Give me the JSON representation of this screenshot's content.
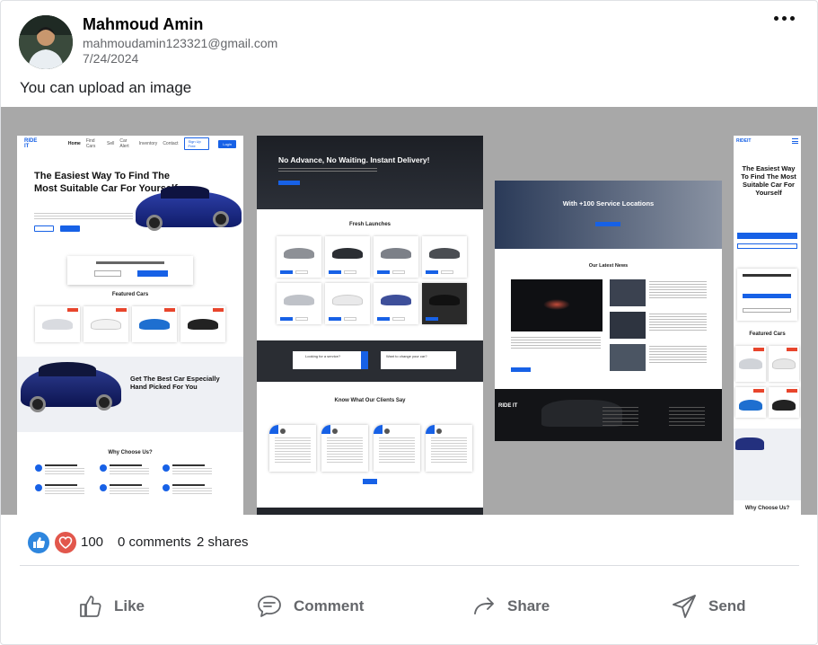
{
  "post": {
    "author": "Mahmoud Amin",
    "email": "mahmoudamin123321@gmail.com",
    "date": "7/24/2024",
    "text": "You can upload an image"
  },
  "gallery": {
    "shot1": {
      "logo": "RIDE IT",
      "nav": [
        "Home",
        "Find Cars",
        "Sell",
        "Car Alert",
        "Inventory",
        "Contact"
      ],
      "sign_up": "Sign Up Free",
      "login": "Login",
      "hero_title": "The Easiest Way To Find The Most Suitable Car For Yourself",
      "search_title": "Not Sure About Which Car To Buy? Find It Here",
      "featured_title": "Featured Cars",
      "band_title": "Get The Best Car Especially Hand Picked For You",
      "why_title": "Why Choose Us?",
      "why_items": [
        "A Variety Of Options",
        "Useful Suggestions",
        "Money Overlooking",
        "Quality Assurance",
        "Match Needs",
        "Good Offers"
      ]
    },
    "shot2": {
      "hero_title": "No Advance, No Waiting. Instant Delivery!",
      "launches_title": "Fresh Launches",
      "search1": "Looking for a service?",
      "search2": "Want to change your car?",
      "clients_title": "Know What Our Clients Say"
    },
    "shot3": {
      "hero_title": "With +100 Service Locations",
      "news_title": "Our Latest News",
      "footer_logo": "RIDE IT"
    },
    "shot4": {
      "logo": "RIDEIT",
      "hero_title": "The Easiest Way To Find The Most Suitable Car For Yourself",
      "featured_title": "Featured Cars",
      "why_title": "Why Choose Us?"
    }
  },
  "stats": {
    "reaction_count": "100",
    "comments": "0 comments",
    "shares": "2 shares"
  },
  "actions": {
    "like": "Like",
    "comment": "Comment",
    "share": "Share",
    "send": "Send"
  },
  "colors": {
    "brand_blue": "#1761e6",
    "like_blue": "#2e86de",
    "love_red": "#e2574c",
    "gallery_bg": "#a8a8a8"
  }
}
